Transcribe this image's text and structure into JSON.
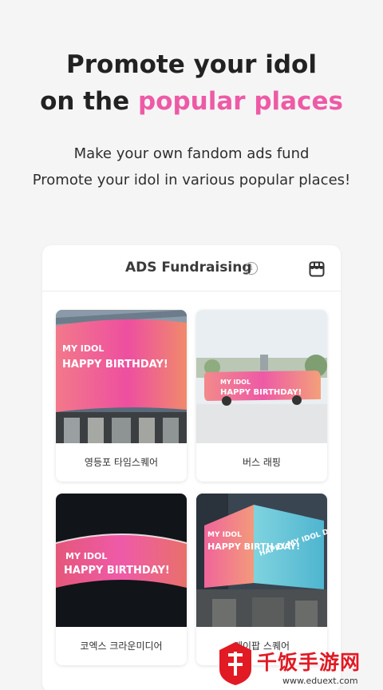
{
  "hero": {
    "title_line1": "Promote your idol",
    "title_line2_prefix": "on the ",
    "title_line2_accent": "popular places",
    "subtitle_line1": "Make your own fandom ads fund",
    "subtitle_line2": "Promote your idol in various popular places!"
  },
  "card": {
    "title": "ADS Fundraising",
    "info_icon": "i",
    "store_icon": "store-icon"
  },
  "tiles": [
    {
      "label": "영등포 타임스퀘어",
      "sign_line1": "MY IDOL",
      "sign_line2": "HAPPY BIRTHDAY!"
    },
    {
      "label": "버스 래핑",
      "sign_line1": "MY IDOL",
      "sign_line2": "HAPPY BIRTHDAY!"
    },
    {
      "label": "코엑스 크라운미디어",
      "sign_line1": "MY IDOL",
      "sign_line2": "HAPPY BIRTHDAY!"
    },
    {
      "label": "케이팝 스퀘어",
      "sign_line1": "MY IDOL",
      "sign_line2": "HAPPY BIRTH DAY!",
      "sign_extra": "HAPPY MY IDOL DAY"
    }
  ],
  "watermark": {
    "text": "千饭手游网",
    "url": "www.eduext.com"
  },
  "colors": {
    "accent": "#ee5aa6",
    "background": "#f5f5f6"
  }
}
